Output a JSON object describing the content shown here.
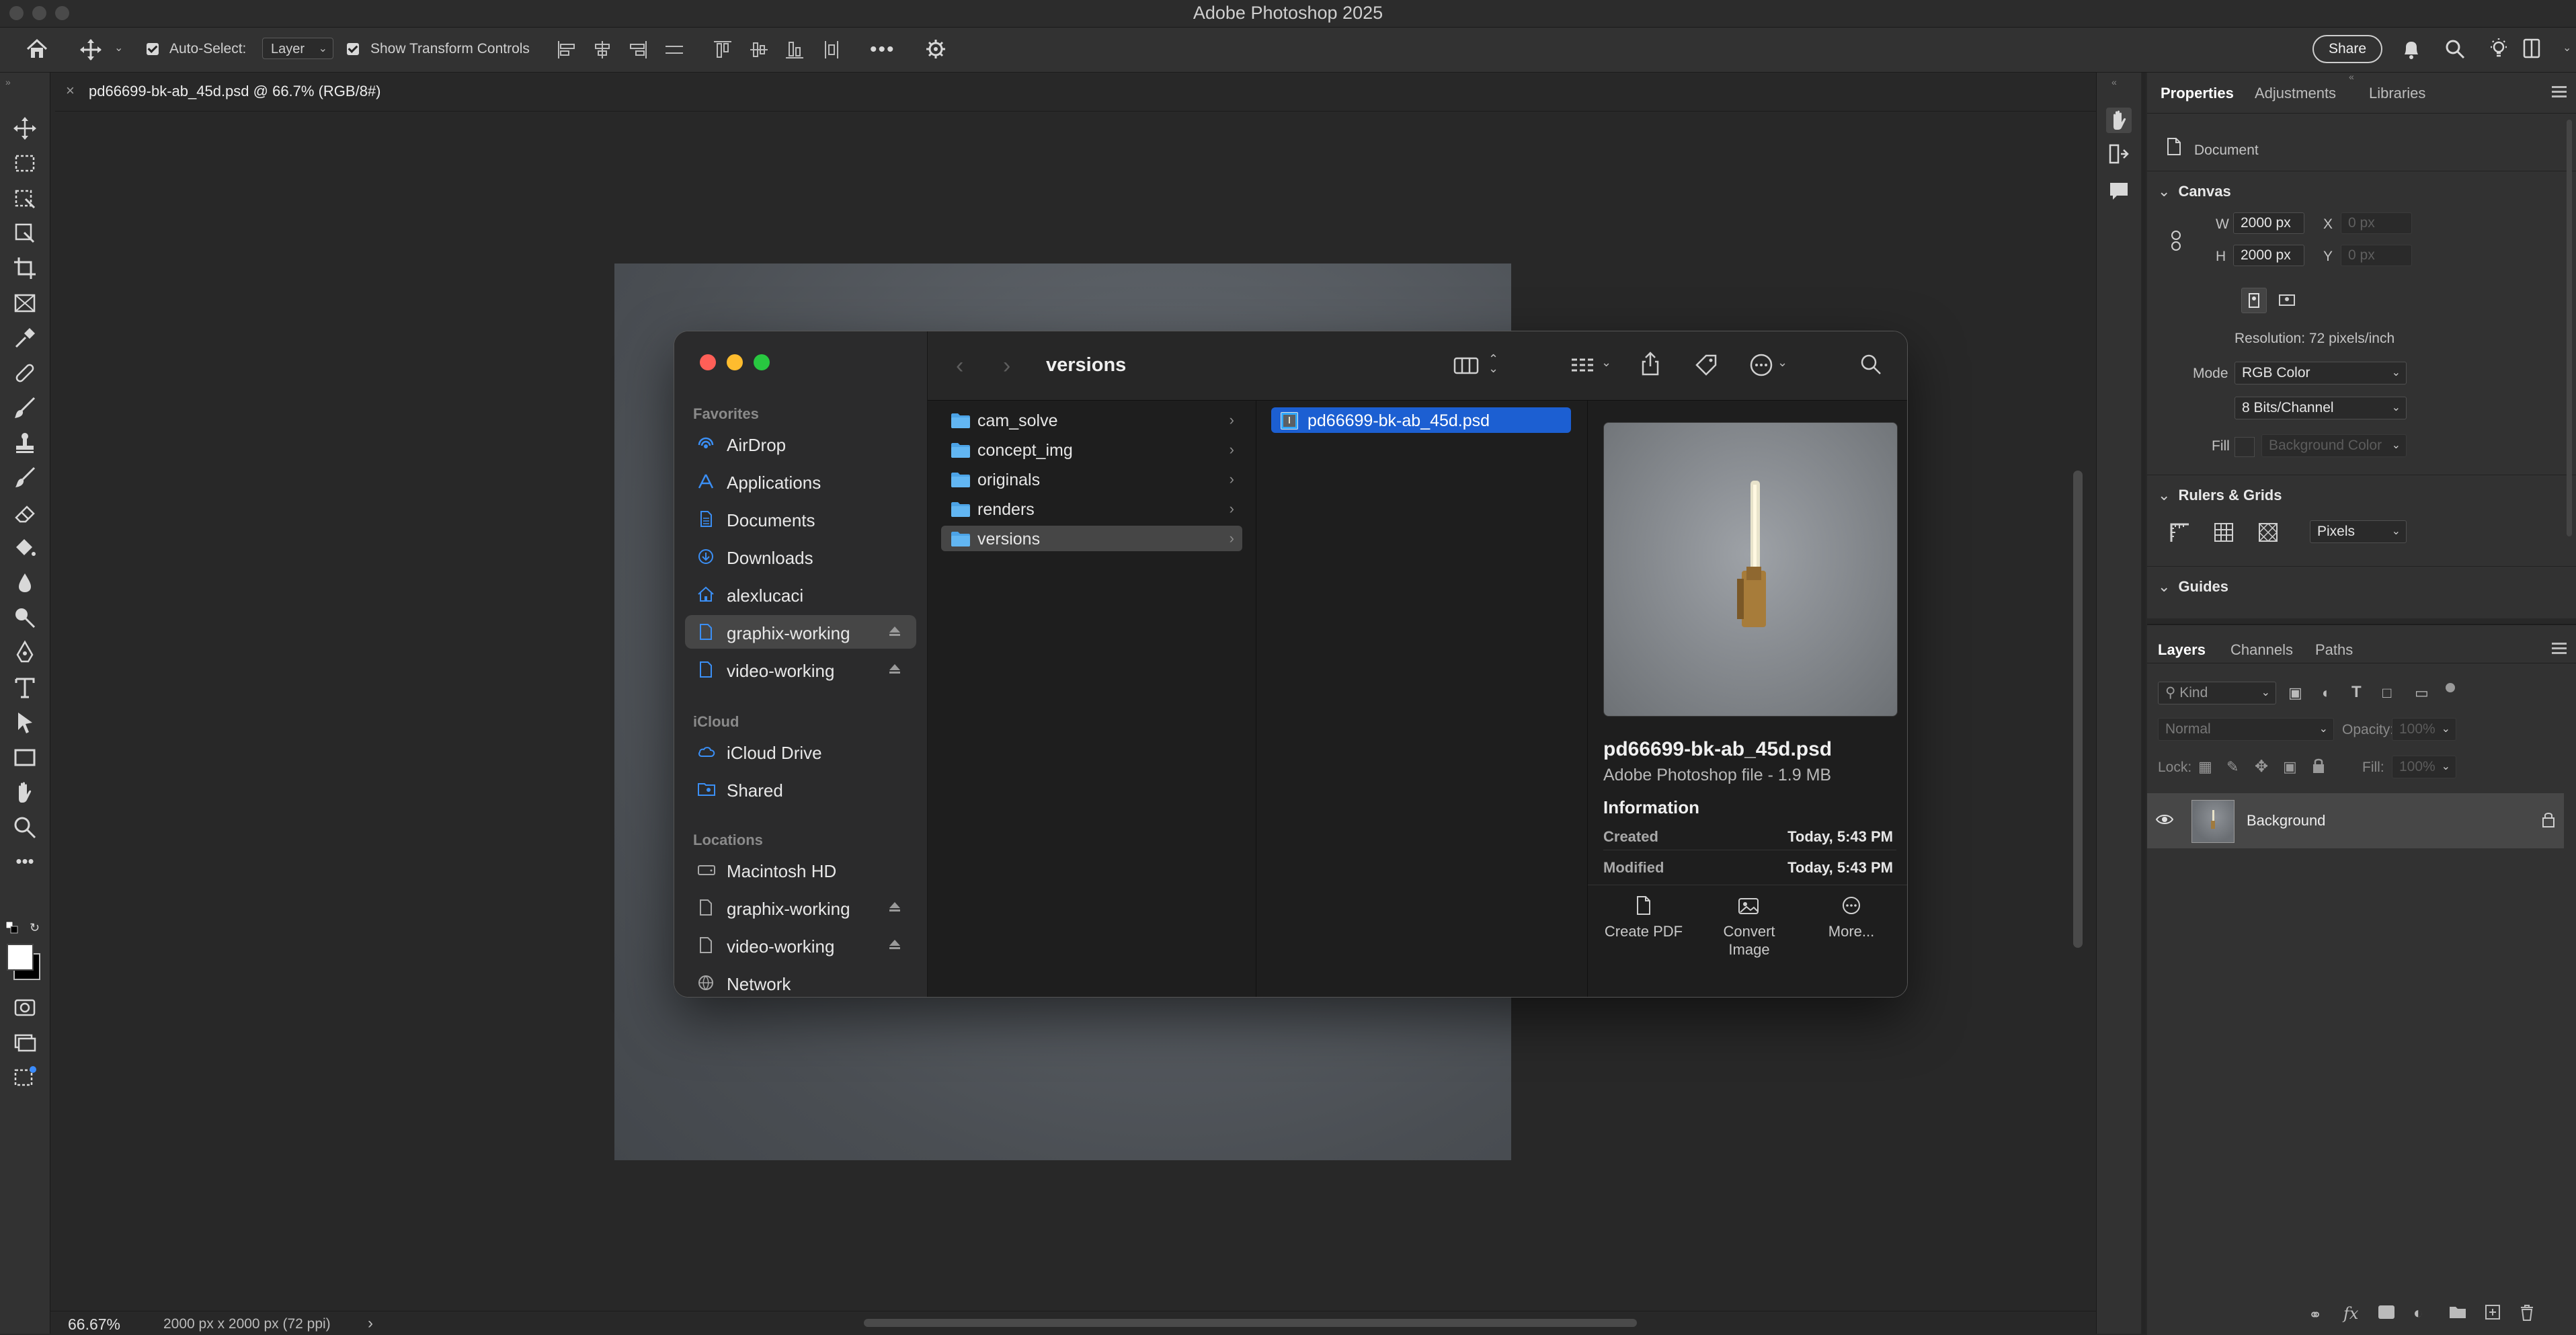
{
  "app": {
    "title": "Adobe Photoshop 2025"
  },
  "options_bar": {
    "auto_select_label": "Auto-Select:",
    "auto_select_value": "Layer",
    "transform_label": "Show Transform Controls",
    "share_label": "Share"
  },
  "document": {
    "tab_label": "pd66699-bk-ab_45d.psd @ 66.7% (RGB/8#)",
    "zoom": "66.67%",
    "info": "2000 px x 2000 px (72 ppi)"
  },
  "properties": {
    "tabs": [
      "Properties",
      "Adjustments",
      "Libraries"
    ],
    "doc_label": "Document",
    "canvas_header": "Canvas",
    "w_label": "W",
    "w_value": "2000 px",
    "h_label": "H",
    "h_value": "2000 px",
    "x_label": "X",
    "x_placeholder": "0 px",
    "y_label": "Y",
    "y_placeholder": "0 px",
    "resolution": "Resolution: 72 pixels/inch",
    "mode_label": "Mode",
    "mode_value": "RGB Color",
    "bits_value": "8 Bits/Channel",
    "fill_label": "Fill",
    "fill_value": "Background Color",
    "rulers_header": "Rulers & Grids",
    "units_value": "Pixels",
    "guides_header": "Guides"
  },
  "layers": {
    "tabs": [
      "Layers",
      "Channels",
      "Paths"
    ],
    "kind_placeholder": "Kind",
    "blend_mode": "Normal",
    "opacity_label": "Opacity:",
    "opacity_value": "100%",
    "lock_label": "Lock:",
    "fill_label": "Fill:",
    "fill_value": "100%",
    "items": [
      {
        "name": "Background"
      }
    ]
  },
  "finder": {
    "title": "versions",
    "sidebar": {
      "favorites_header": "Favorites",
      "favorites": [
        "AirDrop",
        "Applications",
        "Documents",
        "Downloads",
        "alexlucaci",
        "graphix-working",
        "video-working"
      ],
      "icloud_header": "iCloud",
      "icloud": [
        "iCloud Drive",
        "Shared"
      ],
      "locations_header": "Locations",
      "locations": [
        "Macintosh HD",
        "graphix-working",
        "video-working",
        "Network"
      ]
    },
    "column1": [
      "cam_solve",
      "concept_img",
      "originals",
      "renders",
      "versions"
    ],
    "column2": [
      "pd66699-bk-ab_45d.psd"
    ],
    "preview": {
      "name": "pd66699-bk-ab_45d.psd",
      "subtitle": "Adobe Photoshop file - 1.9 MB",
      "info_header": "Information",
      "created_label": "Created",
      "created_value": "Today, 5:43 PM",
      "modified_label": "Modified",
      "modified_value": "Today, 5:43 PM",
      "actions": [
        "Create PDF",
        "Convert Image",
        "More..."
      ]
    }
  },
  "colors": {
    "finder_selection": "#1c5fd2",
    "close": "#ff5f57",
    "minimize": "#febc2e",
    "zoom": "#28c840"
  }
}
